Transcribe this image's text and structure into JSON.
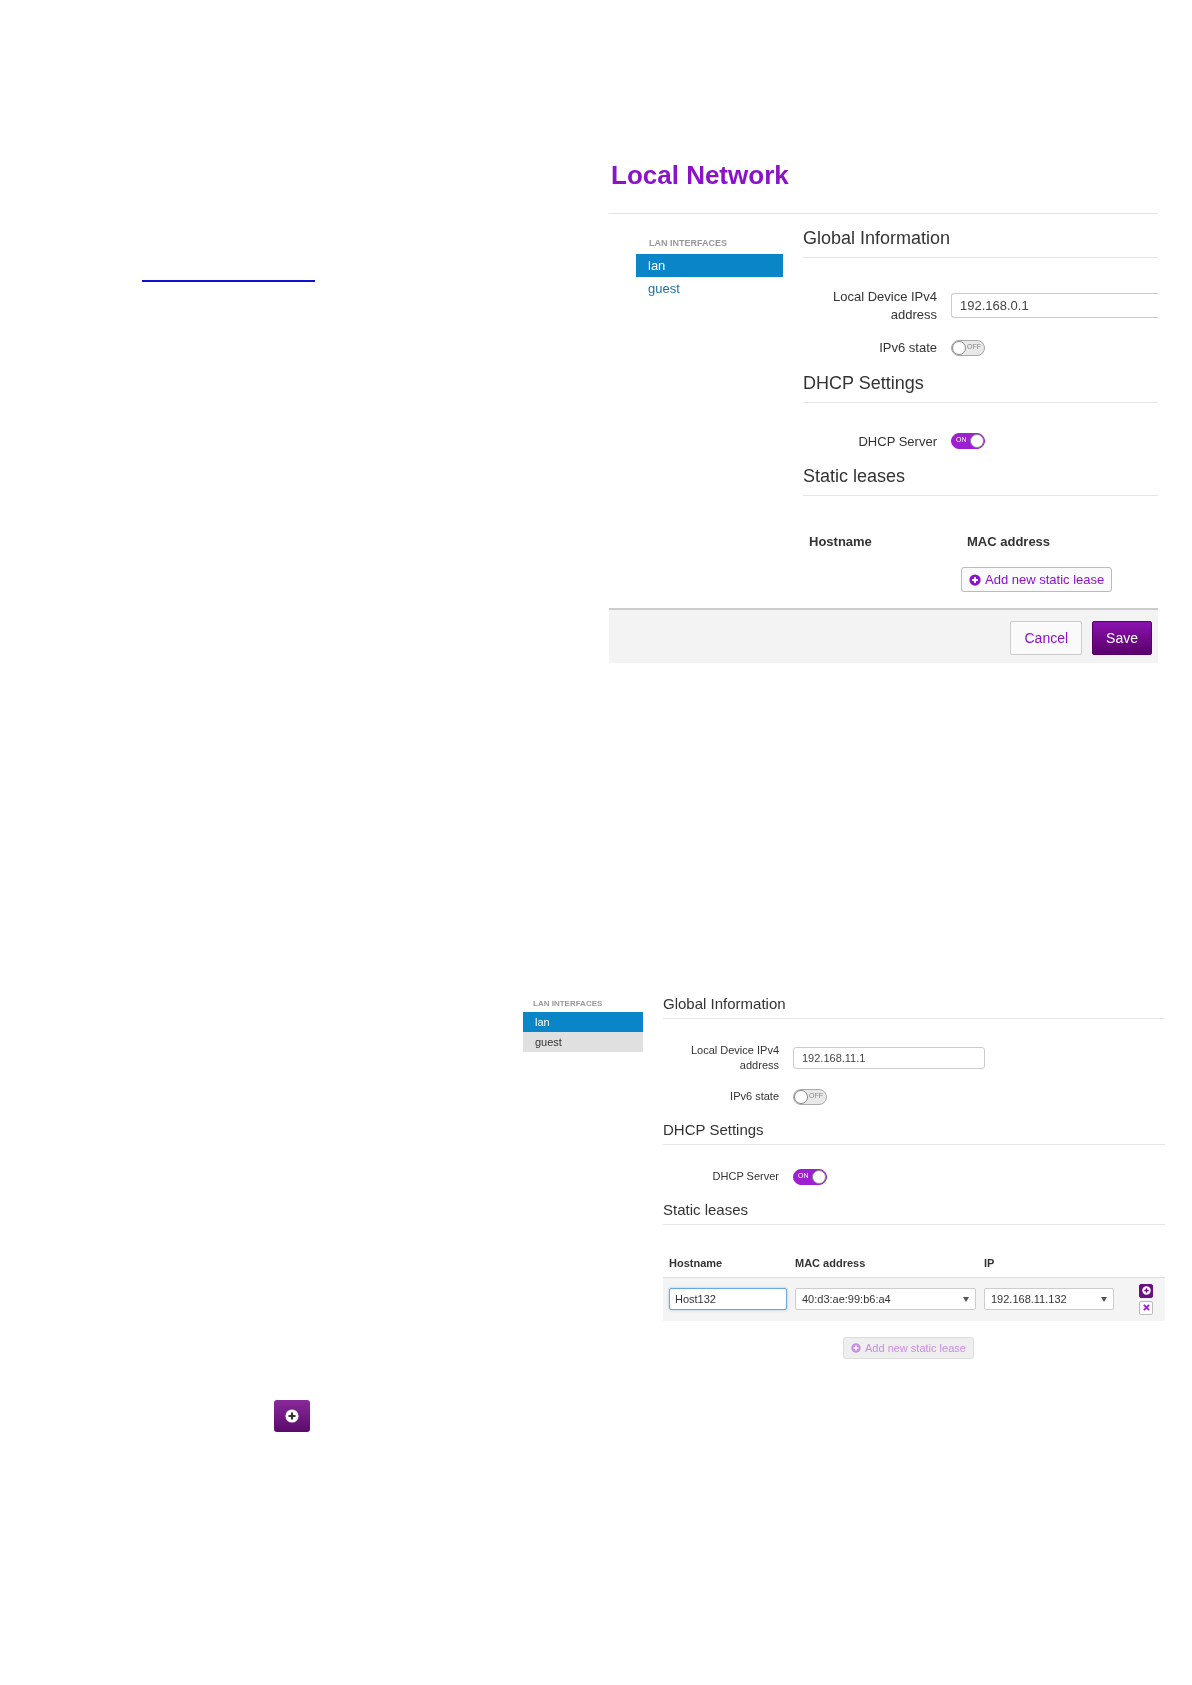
{
  "panels": [
    {
      "title": "Local Network",
      "sidebar": {
        "heading": "LAN INTERFACES",
        "items": [
          {
            "label": "lan",
            "selected": true,
            "hovered": false
          },
          {
            "label": "guest",
            "selected": false,
            "hovered": false
          }
        ]
      },
      "global": {
        "heading": "Global Information",
        "ipv4_label": "Local Device IPv4 address",
        "ipv4_value": "192.168.0.1",
        "ipv6_label": "IPv6 state",
        "ipv6_toggle": {
          "on": false,
          "text": "OFF"
        }
      },
      "dhcp": {
        "heading": "DHCP Settings",
        "server_label": "DHCP Server",
        "server_toggle": {
          "on": true,
          "text": "ON"
        }
      },
      "static_leases": {
        "heading": "Static leases",
        "columns": [
          "Hostname",
          "MAC address"
        ],
        "add_button": {
          "label": "Add new static lease",
          "disabled": false
        }
      },
      "footer": {
        "buttons": [
          {
            "label": "Cancel",
            "kind": "secondary"
          },
          {
            "label": "Save",
            "kind": "primary"
          }
        ]
      }
    },
    {
      "sidebar": {
        "heading": "LAN INTERFACES",
        "items": [
          {
            "label": "lan",
            "selected": true,
            "hovered": false
          },
          {
            "label": "guest",
            "selected": false,
            "hovered": true
          }
        ]
      },
      "global": {
        "heading": "Global Information",
        "ipv4_label": "Local Device IPv4 address",
        "ipv4_value": "192.168.11.1",
        "ipv6_label": "IPv6 state",
        "ipv6_toggle": {
          "on": false,
          "text": "OFF"
        }
      },
      "dhcp": {
        "heading": "DHCP Settings",
        "server_label": "DHCP Server",
        "server_toggle": {
          "on": true,
          "text": "ON"
        }
      },
      "static_leases": {
        "heading": "Static leases",
        "columns": [
          "Hostname",
          "MAC address",
          "IP"
        ],
        "rows": [
          {
            "hostname": "Host132",
            "mac": "40:d3:ae:99:b6:a4",
            "ip": "192.168.11.132"
          }
        ],
        "add_button": {
          "label": "Add new static lease",
          "disabled": true
        }
      }
    }
  ]
}
